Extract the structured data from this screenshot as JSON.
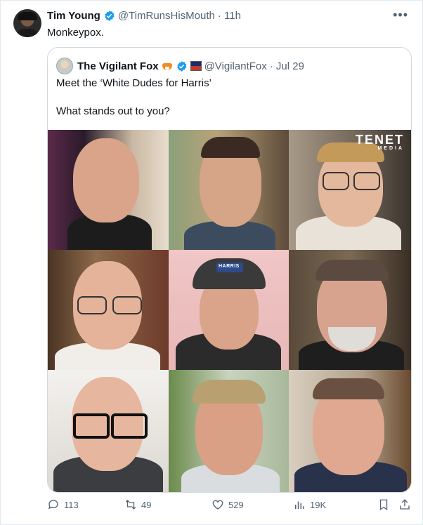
{
  "tweet": {
    "author_name": "Tim Young",
    "handle": "@TimRunsHisMouth",
    "time": "· 11h",
    "text": "Monkeypox."
  },
  "quoted": {
    "author_name": "The Vigilant Fox",
    "handle": "@VigilantFox",
    "date": "· Jul 29",
    "line1": "Meet the ‘White Dudes for Harris’",
    "line2": "What stands out to you?",
    "watermark": "TENET",
    "watermark_sub": "MEDIA",
    "cap_text": "HARRIS"
  },
  "actions": {
    "replies": "113",
    "reposts": "49",
    "likes": "529",
    "views": "19K"
  },
  "colors": {
    "text": "#0f1419",
    "muted": "#536471",
    "verified": "#1d9bf0",
    "border": "#cfd9de"
  },
  "icons": [
    "more-icon",
    "verified-icon",
    "reply-icon",
    "repost-icon",
    "like-icon",
    "views-icon",
    "bookmark-icon",
    "share-icon"
  ]
}
